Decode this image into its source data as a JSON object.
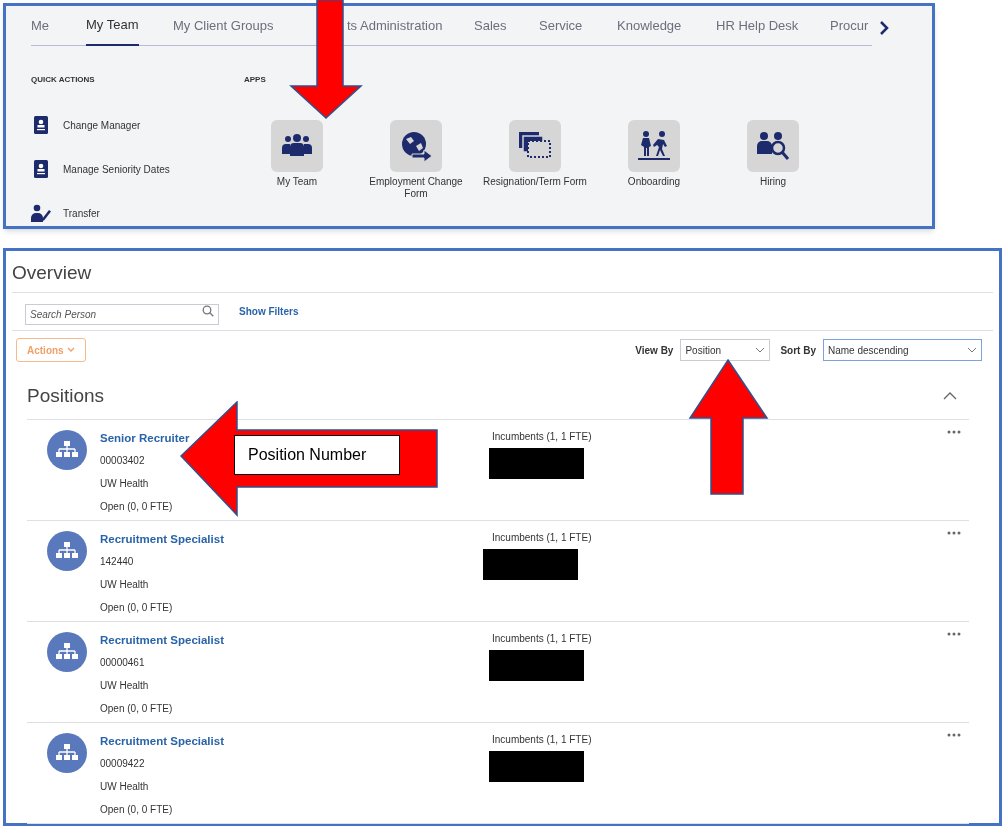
{
  "tabs": [
    {
      "label": "Me",
      "selected": false
    },
    {
      "label": "My Team",
      "selected": true
    },
    {
      "label": "My Client Groups",
      "selected": false
    },
    {
      "label": "ts Administration",
      "selected": false
    },
    {
      "label": "Sales",
      "selected": false
    },
    {
      "label": "Service",
      "selected": false
    },
    {
      "label": "Knowledge",
      "selected": false
    },
    {
      "label": "HR Help Desk",
      "selected": false
    },
    {
      "label": "Procur",
      "selected": false
    }
  ],
  "quick_actions": {
    "title": "QUICK ACTIONS",
    "items": [
      {
        "label": "Change Manager",
        "kind": "badge"
      },
      {
        "label": "Manage Seniority Dates",
        "kind": "badge"
      },
      {
        "label": "Transfer",
        "kind": "person"
      }
    ]
  },
  "apps": {
    "title": "APPS",
    "items": [
      {
        "label": "My Team",
        "kind": "team"
      },
      {
        "label": "Employment Change Form",
        "kind": "globe"
      },
      {
        "label": "Resignation/Term Form",
        "kind": "stack"
      },
      {
        "label": "Onboarding",
        "kind": "walk"
      },
      {
        "label": "Hiring",
        "kind": "hire"
      }
    ]
  },
  "overview": {
    "title": "Overview",
    "search": {
      "placeholder": "Search Person"
    },
    "show_filters": "Show Filters",
    "actions": "Actions",
    "view_by": {
      "label": "View By",
      "value": "Position"
    },
    "sort_by": {
      "label": "Sort By",
      "value": "Name descending"
    }
  },
  "positions": {
    "title": "Positions",
    "rows": [
      {
        "title": "Senior Recruiter",
        "number": "00003402",
        "org": "UW Health",
        "open": "Open (0, 0 FTE)",
        "incumbents": "Incumbents (1, 1 FTE)",
        "redacted": true
      },
      {
        "title": "Recruitment Specialist",
        "number": "142440",
        "org": "UW Health",
        "open": "Open (0, 0 FTE)",
        "incumbents": "Incumbents (1, 1 FTE)",
        "redacted": true
      },
      {
        "title": "Recruitment Specialist",
        "number": "00000461",
        "org": "UW Health",
        "open": "Open (0, 0 FTE)",
        "incumbents": "Incumbents (1, 1 FTE)",
        "redacted": true
      },
      {
        "title": "Recruitment Specialist",
        "number": "00009422",
        "org": "UW Health",
        "open": "Open (0, 0 FTE)",
        "incumbents": "Incumbents (1, 1 FTE)",
        "redacted": true
      }
    ]
  },
  "annotations": [
    {
      "kind": "down"
    },
    {
      "kind": "left",
      "label": "Position Number"
    },
    {
      "kind": "up"
    }
  ]
}
